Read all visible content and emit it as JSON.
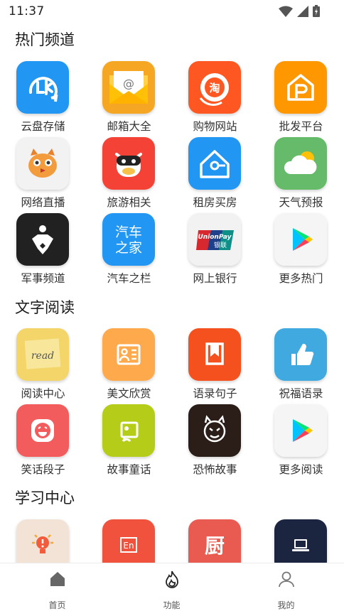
{
  "status_bar": {
    "time": "11:37"
  },
  "sections": [
    {
      "title": "热门频道",
      "items": [
        {
          "label": "云盘存储",
          "icon": "cloud-storage-icon",
          "color": "#2196F3"
        },
        {
          "label": "邮箱大全",
          "icon": "mail-icon",
          "color": "#F5A623"
        },
        {
          "label": "购物网站",
          "icon": "taobao-icon",
          "color": "#FF5722"
        },
        {
          "label": "批发平台",
          "icon": "wholesale-icon",
          "color": "#FF9800"
        },
        {
          "label": "网络直播",
          "icon": "live-stream-icon",
          "color": "#F2F2F2"
        },
        {
          "label": "旅游相关",
          "icon": "travel-icon",
          "color": "#F44336"
        },
        {
          "label": "租房买房",
          "icon": "house-icon",
          "color": "#2196F3"
        },
        {
          "label": "天气预报",
          "icon": "weather-icon",
          "color": "#66BB6A"
        },
        {
          "label": "军事频道",
          "icon": "military-icon",
          "color": "#212121"
        },
        {
          "label": "汽车之栏",
          "icon": "car-home-icon",
          "color": "#2196F3",
          "icon_text": [
            "汽车",
            "之家"
          ]
        },
        {
          "label": "网上银行",
          "icon": "unionpay-icon",
          "color": "#F2F2F2",
          "icon_text": [
            "UnionPay",
            "银联"
          ]
        },
        {
          "label": "更多热门",
          "icon": "play-store-icon",
          "color": "#F5F5F5"
        }
      ]
    },
    {
      "title": "文字阅读",
      "items": [
        {
          "label": "阅读中心",
          "icon": "read-note-icon",
          "color": "#F3D56A",
          "icon_text": [
            "read"
          ]
        },
        {
          "label": "美文欣赏",
          "icon": "article-card-icon",
          "color": "#FFA94D"
        },
        {
          "label": "语录句子",
          "icon": "bookmark-icon",
          "color": "#F4511E"
        },
        {
          "label": "祝福语录",
          "icon": "thumbs-up-icon",
          "color": "#3FA9E0"
        },
        {
          "label": "笑话段子",
          "icon": "laugh-icon",
          "color": "#F25C5C"
        },
        {
          "label": "故事童话",
          "icon": "story-icon",
          "color": "#B5CC18"
        },
        {
          "label": "恐怖故事",
          "icon": "devil-icon",
          "color": "#2B1D18"
        },
        {
          "label": "更多阅读",
          "icon": "play-store-icon",
          "color": "#F5F5F5"
        }
      ]
    },
    {
      "title": "学习中心",
      "items": [
        {
          "label": "",
          "icon": "idea-bulb-icon",
          "color": "#F3E3D6"
        },
        {
          "label": "",
          "icon": "english-icon",
          "color": "#F0523E",
          "icon_text": [
            "En"
          ]
        },
        {
          "label": "",
          "icon": "kitchen-icon",
          "color": "#E95B50",
          "icon_text": [
            "厨"
          ]
        },
        {
          "label": "",
          "icon": "laptop-icon",
          "color": "#1B2540"
        }
      ]
    }
  ],
  "bottom_nav": [
    {
      "label": "首页",
      "icon": "home-icon"
    },
    {
      "label": "功能",
      "icon": "flame-icon"
    },
    {
      "label": "我的",
      "icon": "person-icon"
    }
  ]
}
